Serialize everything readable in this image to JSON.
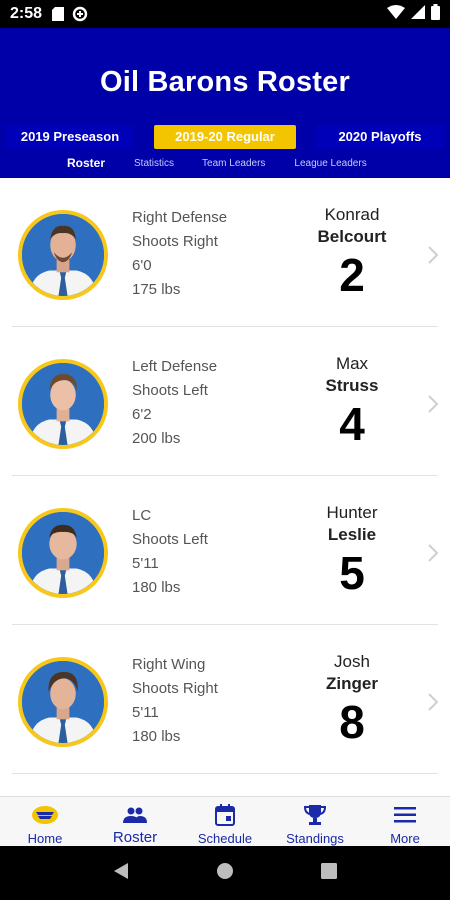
{
  "status_bar": {
    "time": "2:58",
    "icons": [
      "sd-card-icon",
      "data-saver-icon",
      "wifi-icon",
      "signal-icon",
      "battery-icon"
    ]
  },
  "header": {
    "title": "Oil Barons Roster",
    "background_color": "#0000a8",
    "accent_color": "#f2c500"
  },
  "seasons": [
    {
      "label": "2019 Preseason",
      "active": false
    },
    {
      "label": "2019-20 Regular",
      "active": true
    },
    {
      "label": "2020 Playoffs",
      "active": false
    }
  ],
  "subnav": [
    {
      "label": "Roster",
      "active": true
    },
    {
      "label": "Statistics",
      "active": false
    },
    {
      "label": "Team Leaders",
      "active": false
    },
    {
      "label": "League Leaders",
      "active": false
    }
  ],
  "players": [
    {
      "position": "Right Defense",
      "shoots": "Shoots Right",
      "height": "6'0",
      "weight": "175 lbs",
      "first": "Konrad",
      "last": "Belcourt",
      "number": "2"
    },
    {
      "position": "Left Defense",
      "shoots": "Shoots Left",
      "height": "6'2",
      "weight": "200 lbs",
      "first": "Max",
      "last": "Struss",
      "number": "4"
    },
    {
      "position": "LC",
      "shoots": "Shoots Left",
      "height": "5'11",
      "weight": "180 lbs",
      "first": "Hunter",
      "last": "Leslie",
      "number": "5"
    },
    {
      "position": "Right Wing",
      "shoots": "Shoots Right",
      "height": "5'11",
      "weight": "180 lbs",
      "first": "Josh",
      "last": "Zinger",
      "number": "8"
    }
  ],
  "bottom_nav": [
    {
      "label": "Home",
      "icon": "team-logo-icon",
      "active": false
    },
    {
      "label": "Roster",
      "icon": "people-icon",
      "active": true
    },
    {
      "label": "Schedule",
      "icon": "calendar-icon",
      "active": false
    },
    {
      "label": "Standings",
      "icon": "trophy-icon",
      "active": false
    },
    {
      "label": "More",
      "icon": "menu-icon",
      "active": false
    }
  ]
}
